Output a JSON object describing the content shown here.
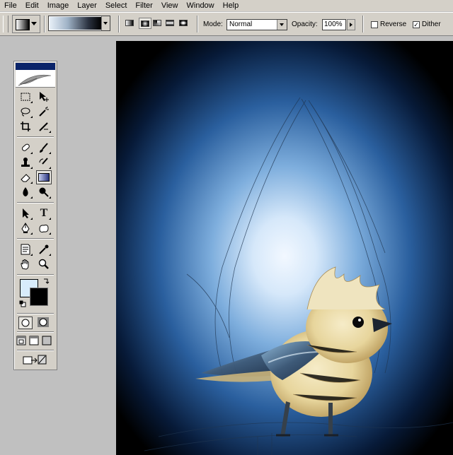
{
  "menu": [
    "File",
    "Edit",
    "Image",
    "Layer",
    "Select",
    "Filter",
    "View",
    "Window",
    "Help"
  ],
  "options": {
    "mode_label": "Mode:",
    "mode_value": "Normal",
    "opacity_label": "Opacity:",
    "opacity_value": "100%",
    "reverse_label": "Reverse",
    "reverse_checked": false,
    "dither_label": "Dither",
    "dither_checked": true,
    "gradient_types": [
      "linear",
      "radial",
      "angle",
      "reflected",
      "diamond"
    ],
    "selected_gradient_type": "radial"
  },
  "colors": {
    "foreground": "#d8ecfb",
    "background": "#000000",
    "ui_face": "#d4d0c8"
  },
  "toolbox": {
    "tools": [
      "marquee",
      "move",
      "lasso",
      "magic-wand",
      "crop",
      "slice",
      "healing-brush",
      "brush",
      "clone-stamp",
      "history-brush",
      "eraser",
      "gradient",
      "blur",
      "dodge",
      "path-selection",
      "type",
      "pen",
      "custom-shape",
      "notes",
      "eyedropper",
      "hand",
      "zoom"
    ],
    "active_tool": "gradient",
    "type_tool_glyph": "T"
  }
}
